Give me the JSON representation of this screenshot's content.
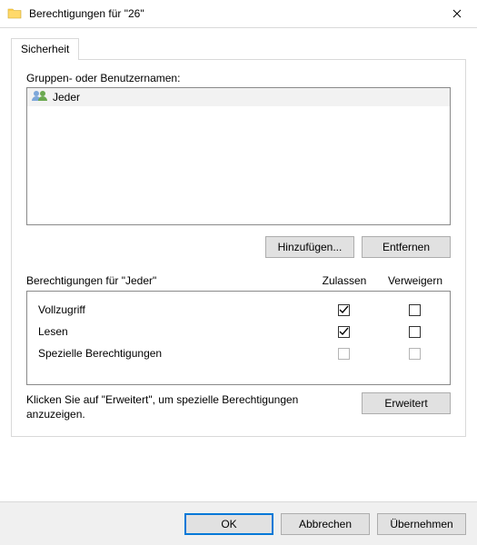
{
  "window": {
    "title": "Berechtigungen für \"26\""
  },
  "tab": {
    "label": "Sicherheit"
  },
  "groups": {
    "label": "Gruppen- oder Benutzernamen:",
    "items": [
      {
        "name": "Jeder"
      }
    ]
  },
  "buttons": {
    "add": "Hinzufügen...",
    "remove": "Entfernen",
    "advanced": "Erweitert",
    "ok": "OK",
    "cancel": "Abbrechen",
    "apply": "Übernehmen"
  },
  "perm_header": {
    "title": "Berechtigungen für \"Jeder\"",
    "allow": "Zulassen",
    "deny": "Verweigern"
  },
  "permissions": [
    {
      "name": "Vollzugriff",
      "allow": true,
      "deny": false,
      "disabled": false
    },
    {
      "name": "Lesen",
      "allow": true,
      "deny": false,
      "disabled": false
    },
    {
      "name": "Spezielle Berechtigungen",
      "allow": false,
      "deny": false,
      "disabled": true
    }
  ],
  "hint": "Klicken Sie auf \"Erweitert\", um spezielle Berechtigungen anzuzeigen."
}
